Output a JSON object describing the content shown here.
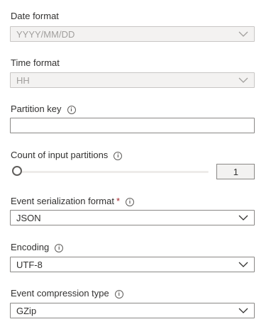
{
  "date_format": {
    "label": "Date format",
    "value": "YYYY/MM/DD",
    "disabled": true
  },
  "time_format": {
    "label": "Time format",
    "value": "HH",
    "disabled": true
  },
  "partition_key": {
    "label": "Partition key",
    "value": ""
  },
  "count_partitions": {
    "label": "Count of input partitions",
    "value": "1"
  },
  "serialization": {
    "label": "Event serialization format",
    "required_mark": "*",
    "value": "JSON"
  },
  "encoding": {
    "label": "Encoding",
    "value": "UTF-8"
  },
  "compression": {
    "label": "Event compression type",
    "value": "GZip"
  },
  "icons": {
    "info": "info-icon",
    "dropdown": "chevron-down-icon"
  },
  "colors": {
    "required": "#a4262c",
    "border": "#8a8886",
    "disabled_bg": "#f3f2f1"
  }
}
